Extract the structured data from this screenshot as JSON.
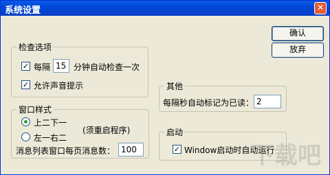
{
  "window": {
    "title": "系统设置",
    "close_glyph": "✕"
  },
  "buttons": {
    "ok": "确认",
    "cancel": "放弃"
  },
  "check_options": {
    "legend": "检查选项",
    "interval_prefix": "每隔",
    "interval_value": "15",
    "interval_suffix": "分钟自动检查一次",
    "interval_checked": true,
    "sound_label": "允许声音提示",
    "sound_checked": true
  },
  "window_style": {
    "legend": "窗口样式",
    "option1": "上二下一",
    "option2": "左一右二",
    "selected": "上二下一",
    "restart_note": "(须重启程序)",
    "per_page_label": "消息列表窗口每页消息数：",
    "per_page_value": "100"
  },
  "other": {
    "legend": "其他",
    "mark_read_label": "每隔秒自动标记为已读：",
    "mark_read_value": "2"
  },
  "startup": {
    "legend": "启动",
    "auto_run_label": "Window启动时自动运行",
    "auto_run_checked": true
  },
  "watermark": "下载吧",
  "check_glyph": "✓"
}
